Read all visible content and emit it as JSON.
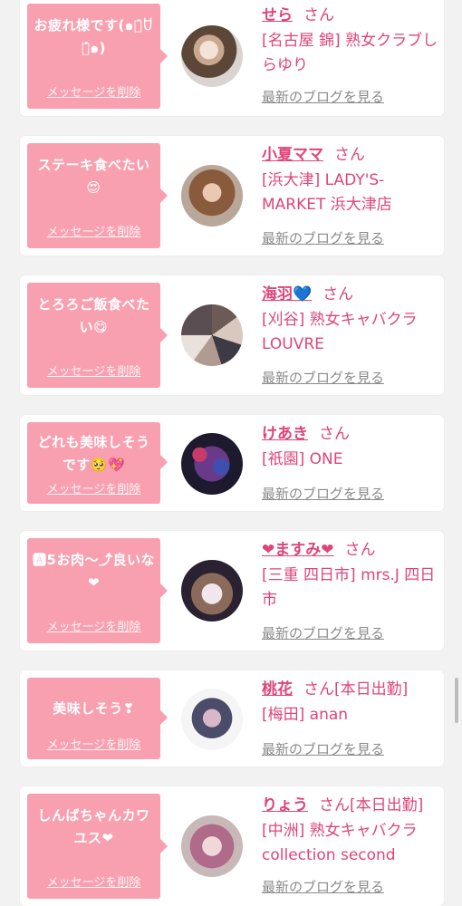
{
  "colors": {
    "background": "#f2f2f2",
    "card": "#ffffff",
    "bubble": "#f8a0b0",
    "accent": "#e0447a",
    "link_gray": "#8a8a8a"
  },
  "delete_label": "メッセージを削除",
  "blog_label": "最新のブログを見る",
  "entries": [
    {
      "message": "お疲れ様です(๑꒪̇ꇴ꒪̇๑)",
      "name": "せら",
      "suffix": "さん",
      "shop": "[名古屋 錦] 熟女クラブしらゆり"
    },
    {
      "message": "ステーキ食べたい😍",
      "name": "小夏ママ",
      "suffix": "さん",
      "shop": "[浜大津] LADY'S-MARKET 浜大津店"
    },
    {
      "message": "とろろご飯食べたい😋",
      "name": "海羽💙",
      "suffix": "さん",
      "shop": "[刈谷] 熟女キャバクラLOUVRE"
    },
    {
      "message": "どれも美味しそうです🥺💖",
      "name": "けあき",
      "suffix": "さん",
      "shop": "[祇園] ONE"
    },
    {
      "message": "🅰5お肉〜⤴良いな❤",
      "name": "❤ますみ❤",
      "suffix": "さん",
      "shop": "[三重 四日市] mrs.J 四日市"
    },
    {
      "message": "美味しそう❣",
      "name": "桃花",
      "suffix": "さん[本日出勤]",
      "shop": "[梅田] anan"
    },
    {
      "message": "しんばちゃんカワユス❤",
      "name": "りょう",
      "suffix": "さん[本日出勤]",
      "shop": "[中洲] 熟女キャバクラcollection second"
    }
  ]
}
